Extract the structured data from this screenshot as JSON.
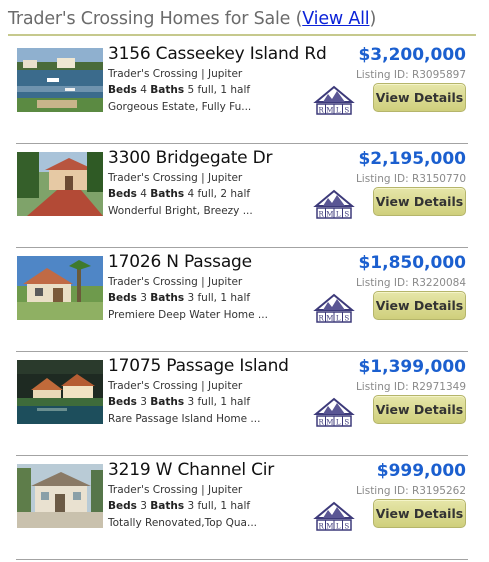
{
  "header": {
    "title": "Trader's Crossing Homes for Sale",
    "open_paren": "(",
    "view_all": "View All",
    "close_paren": ")"
  },
  "listings": [
    {
      "address": "3156 Casseekey Island Rd",
      "location": "Trader's Crossing | Jupiter",
      "beds_label": "Beds",
      "beds": "4",
      "baths_label": "Baths",
      "baths_detail": "5 full, 1 half",
      "description": "Gorgeous Estate, Fully Fu...",
      "price": "$3,200,000",
      "listing_id": "Listing ID: R3095897",
      "button": "View Details"
    },
    {
      "address": "3300 Bridgegate Dr",
      "location": "Trader's Crossing | Jupiter",
      "beds_label": "Beds",
      "beds": "4",
      "baths_label": "Baths",
      "baths_detail": "4 full, 2 half",
      "description": "Wonderful Bright, Breezy ...",
      "price": "$2,195,000",
      "listing_id": "Listing ID: R3150770",
      "button": "View Details"
    },
    {
      "address": "17026 N Passage",
      "location": "Trader's Crossing | Jupiter",
      "beds_label": "Beds",
      "beds": "3",
      "baths_label": "Baths",
      "baths_detail": "3 full, 1 half",
      "description": "Premiere Deep Water Home ...",
      "price": "$1,850,000",
      "listing_id": "Listing ID: R3220084",
      "button": "View Details"
    },
    {
      "address": "17075 Passage Island",
      "location": "Trader's Crossing | Jupiter",
      "beds_label": "Beds",
      "beds": "3",
      "baths_label": "Baths",
      "baths_detail": "3 full, 1 half",
      "description": "Rare Passage Island Home ...",
      "price": "$1,399,000",
      "listing_id": "Listing ID: R2971349",
      "button": "View Details"
    },
    {
      "address": "3219 W Channel Cir",
      "location": "Trader's Crossing | Jupiter",
      "beds_label": "Beds",
      "beds": "3",
      "baths_label": "Baths",
      "baths_detail": "3 full, 1 half",
      "description": "Totally Renovated,Top Qua...",
      "price": "$999,000",
      "listing_id": "Listing ID: R3195262",
      "button": "View Details"
    }
  ],
  "rmls_logo": {
    "text": "RMLS"
  },
  "colors": {
    "price": "#1b5fcf",
    "button": "#d9d98c",
    "header_rule": "#c6c98d",
    "link": "#0b22d8"
  }
}
